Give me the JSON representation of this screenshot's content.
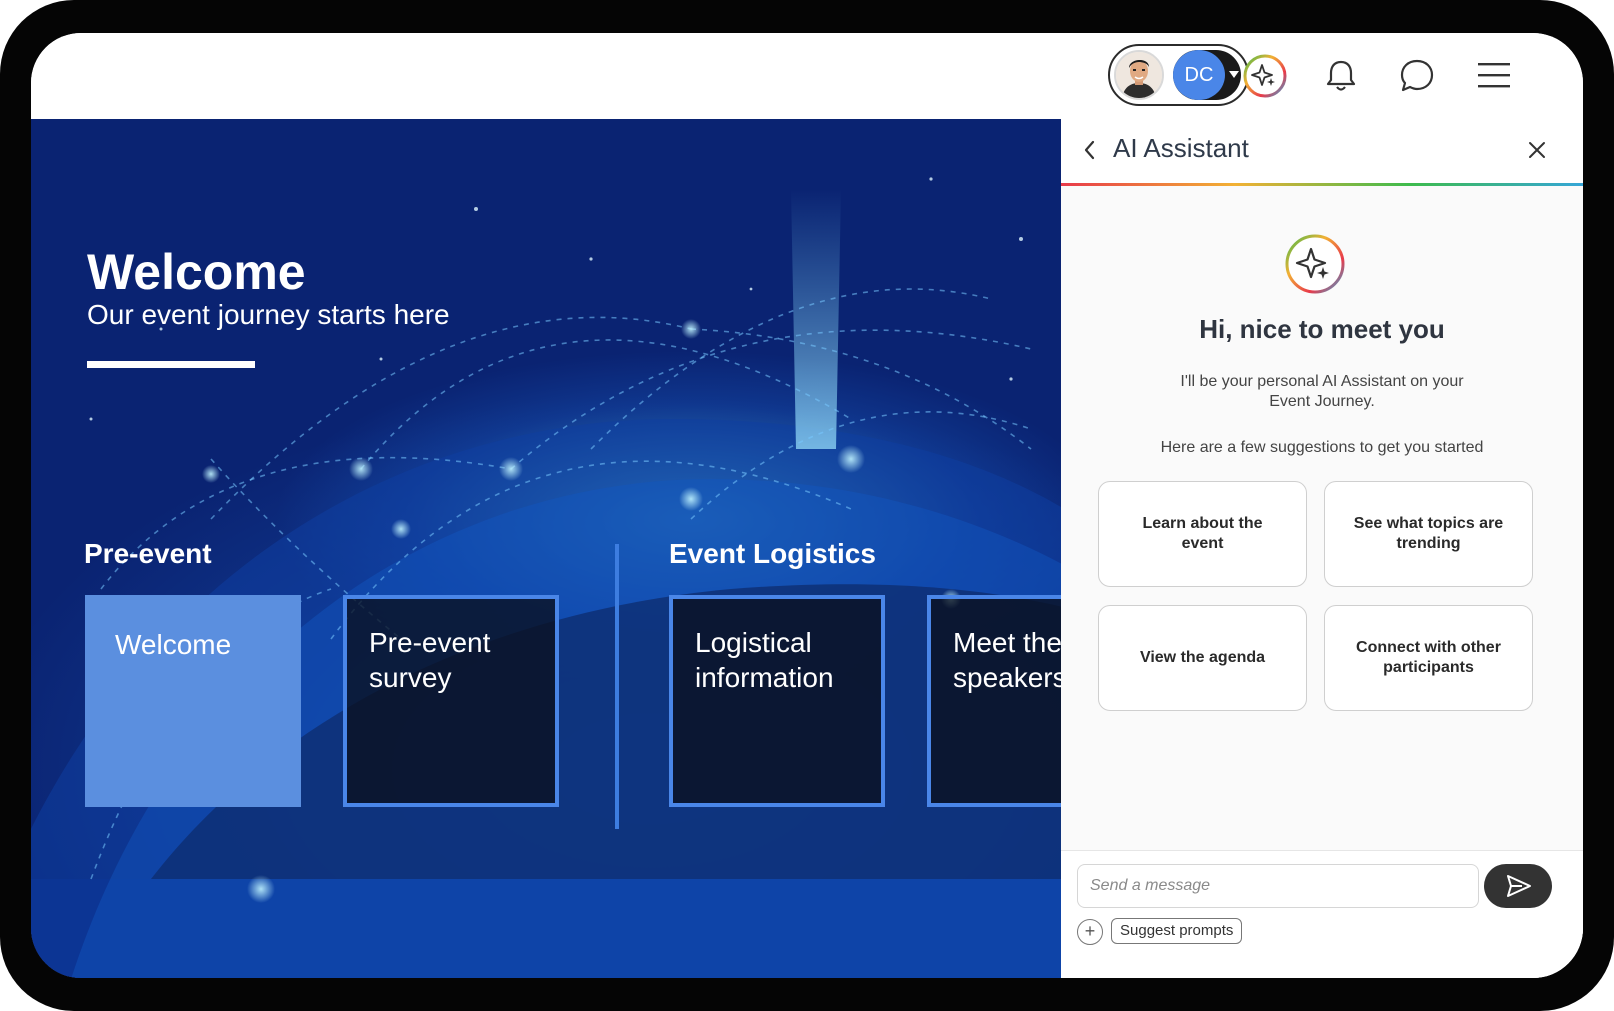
{
  "header": {
    "user_initials": "DC",
    "icons": [
      "ai-sparkle-icon",
      "bell-icon",
      "chat-bubble-icon",
      "hamburger-menu-icon"
    ]
  },
  "hero": {
    "title": "Welcome",
    "subtitle": "Our event journey starts here",
    "sections": [
      {
        "label": "Pre-event",
        "tiles": [
          {
            "label": "Welcome",
            "active": true
          },
          {
            "label": "Pre-event survey",
            "active": false
          }
        ]
      },
      {
        "label": "Event Logistics",
        "tiles": [
          {
            "label": "Logistical information",
            "active": false
          },
          {
            "label": "Meet the speakers",
            "active": false
          }
        ]
      }
    ]
  },
  "assistant": {
    "title": "AI Assistant",
    "greeting": "Hi, nice to meet you",
    "intro": "I'll be your personal AI Assistant on your Event Journey.",
    "suggestions_intro": "Here are a few suggestions to get you started",
    "suggestions": [
      "Learn about the event",
      "See what topics are trending",
      "View the agenda",
      "Connect with other participants"
    ],
    "input_placeholder": "Send a message",
    "plus_label": "+",
    "suggest_prompts_label": "Suggest prompts"
  },
  "colors": {
    "accent_blue": "#4a86e8",
    "hero_navy": "#0a2372",
    "device_frame": "#050505"
  }
}
